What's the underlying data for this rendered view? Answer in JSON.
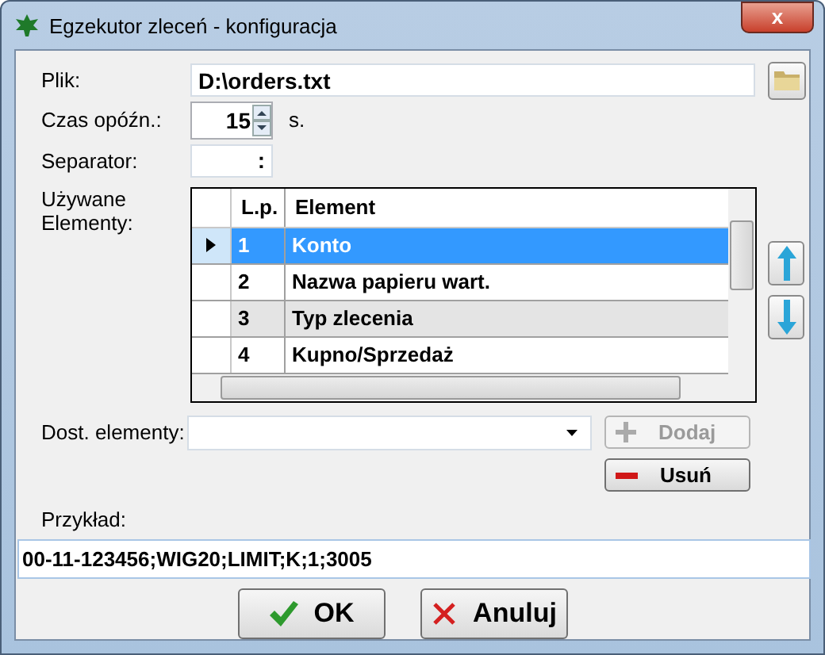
{
  "window": {
    "title": "Egzekutor zleceń - konfiguracja",
    "close": "x"
  },
  "file": {
    "label": "Plik:",
    "value": "D:\\orders.txt"
  },
  "delay": {
    "label": "Czas opóźn.:",
    "value": "15",
    "unit": "s."
  },
  "separator": {
    "label": "Separator:",
    "value": ":"
  },
  "used": {
    "label": "Używane Elementy:",
    "columns": [
      "L.p.",
      "Element"
    ],
    "rows": [
      {
        "no": "1",
        "element": "Konto",
        "selected": true,
        "shaded": false
      },
      {
        "no": "2",
        "element": "Nazwa papieru wart.",
        "selected": false,
        "shaded": false
      },
      {
        "no": "3",
        "element": "Typ zlecenia",
        "selected": false,
        "shaded": true
      },
      {
        "no": "4",
        "element": "Kupno/Sprzedaż",
        "selected": false,
        "shaded": false
      }
    ]
  },
  "available": {
    "label": "Dost. elementy:",
    "add": {
      "label": "Dodaj",
      "disabled": true
    },
    "remove": {
      "label": "Usuń",
      "disabled": false
    }
  },
  "example": {
    "label": "Przykład:",
    "value": "00-11-123456;WIG20;LIMIT;K;1;3005"
  },
  "buttons": [
    {
      "kind": "ok",
      "label": "OK"
    },
    {
      "kind": "cancel",
      "label": "Anuluj"
    }
  ]
}
